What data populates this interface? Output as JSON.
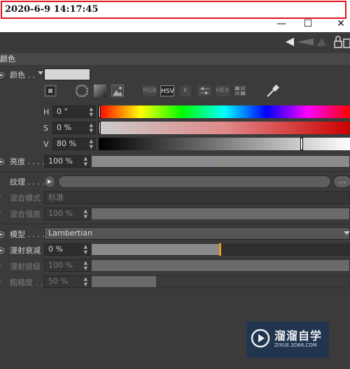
{
  "timestamp": "2020-6-9 14:17:45",
  "window": {
    "minimize": "—",
    "maximize": "☐",
    "close": "✕"
  },
  "section": {
    "title": "颜色"
  },
  "color": {
    "label": "颜色 . .",
    "swatch_color": "#d6d6d6",
    "modes": [
      "RGB",
      "HSV",
      "K",
      "",
      "HEX",
      ""
    ],
    "active_mode": "HSV",
    "h": {
      "label": "H",
      "value": "0 °"
    },
    "s": {
      "label": "S",
      "value": "0 %"
    },
    "v": {
      "label": "V",
      "value": "80 %"
    }
  },
  "brightness": {
    "label": "亮度 . . . .",
    "value": "100 %",
    "level": 1.0
  },
  "texture": {
    "label": "纹理 . . . . .",
    "more": "..."
  },
  "mix_mode": {
    "label": "混合模式",
    "value": "标准"
  },
  "mix_strength": {
    "label": "混合强度",
    "value": "100 %",
    "level": 1.0
  },
  "model": {
    "label": "模型 . . . .",
    "value": "Lambertian"
  },
  "diffuse_falloff": {
    "label": "漫射衰减",
    "value": "0 %",
    "level": 0.5
  },
  "diffuse_level": {
    "label": "漫射层级",
    "value": "100 %",
    "level": 1.0
  },
  "roughness": {
    "label": "粗糙度 . . .",
    "value": "50 %",
    "level": 0.25
  },
  "watermark": {
    "title": "溜溜自学",
    "url": "ZIXUE.3D66.COM"
  }
}
